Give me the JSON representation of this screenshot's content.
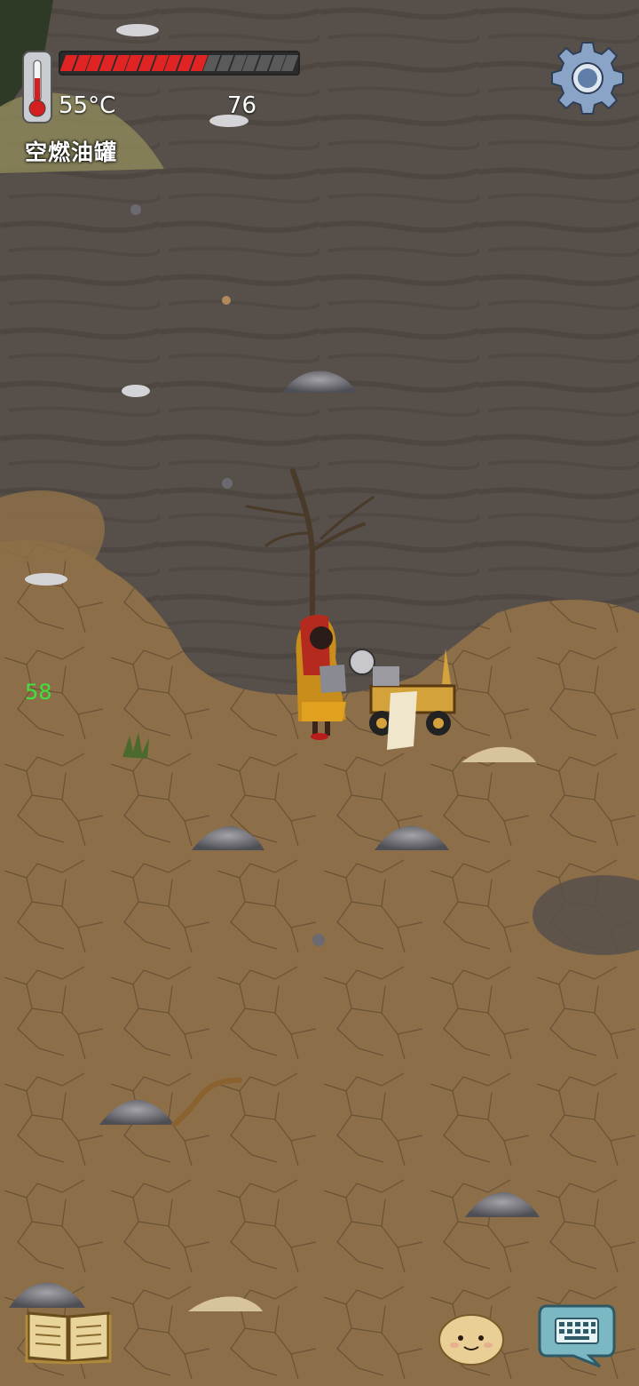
{
  "hud": {
    "temperature": "55°C",
    "age": "76",
    "held_item": "空燃油罐",
    "food_bar": {
      "total_segments": 18,
      "filled_segments": 11,
      "filled_color": "#e02424",
      "empty_color": "#5a5a5a"
    },
    "settings_icon": "gear-icon"
  },
  "world": {
    "counter": "58",
    "ground_colors": {
      "ash": "#57504a",
      "badlands": "#8c6e48"
    }
  },
  "bottom_bar": {
    "book_icon": "book-icon",
    "emote_icon": "emote-face-icon",
    "keyboard_icon": "keyboard-chat-icon"
  }
}
